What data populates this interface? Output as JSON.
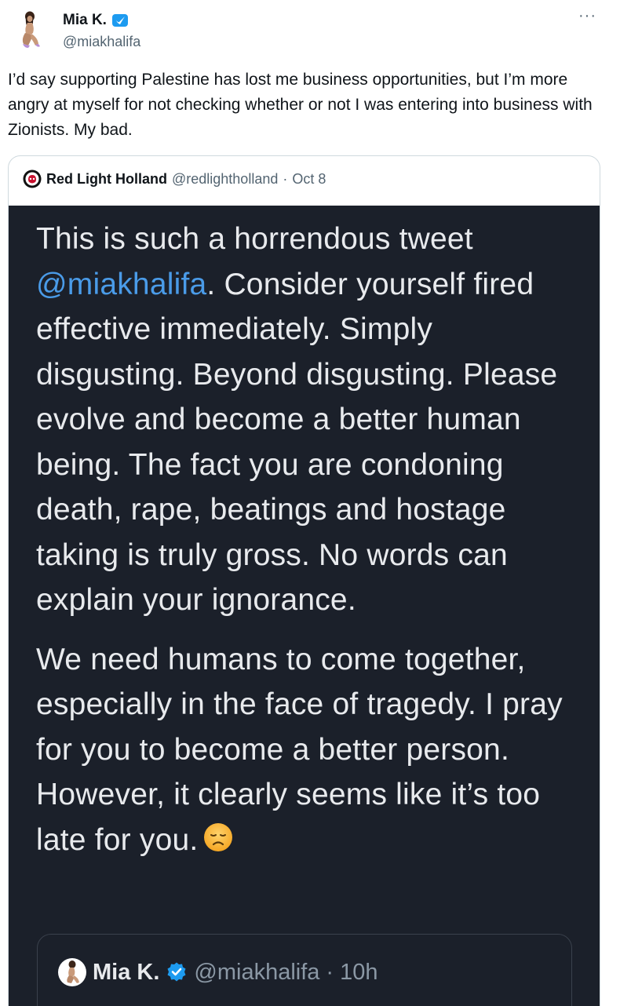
{
  "tweet": {
    "author_name": "Mia K.",
    "author_handle": "@miakhalifa",
    "more_label": "···",
    "text": "I’d say supporting Palestine has lost me business opportunities, but I’m more angry at myself for not checking whether or not I was entering into business with Zionists. My bad."
  },
  "quoted": {
    "author_name": "Red Light Holland",
    "author_handle": "@redlightholland",
    "separator": "·",
    "date": "Oct 8",
    "image_text": {
      "p1_start": "This is such a horrendous tweet ",
      "p1_mention": "@miakhalifa",
      "p1_rest": ". Consider yourself fired effective immediately. Simply disgusting. Beyond disgusting. Please evolve and become a better human being. The fact you are condoning death, rape, beatings and hostage taking is truly gross. No words can explain your ignorance.",
      "p2": "We need humans to come together, especially in the face of tragedy. I pray for you to become a better person. However, it clearly seems like it’s too late for you."
    },
    "inner_quote": {
      "author_name": "Mia K.",
      "author_handle": "@miakhalifa",
      "separator": "·",
      "time": "10h"
    }
  },
  "icons": {
    "verified": "verified-badge-icon",
    "emoji": "disappointed-face-emoji",
    "quoted_avatar": "red-light-holland-logo"
  },
  "colors": {
    "verified_blue": "#1d9bf0",
    "mention_blue": "#4a9be8",
    "image_background": "#1b202a"
  }
}
